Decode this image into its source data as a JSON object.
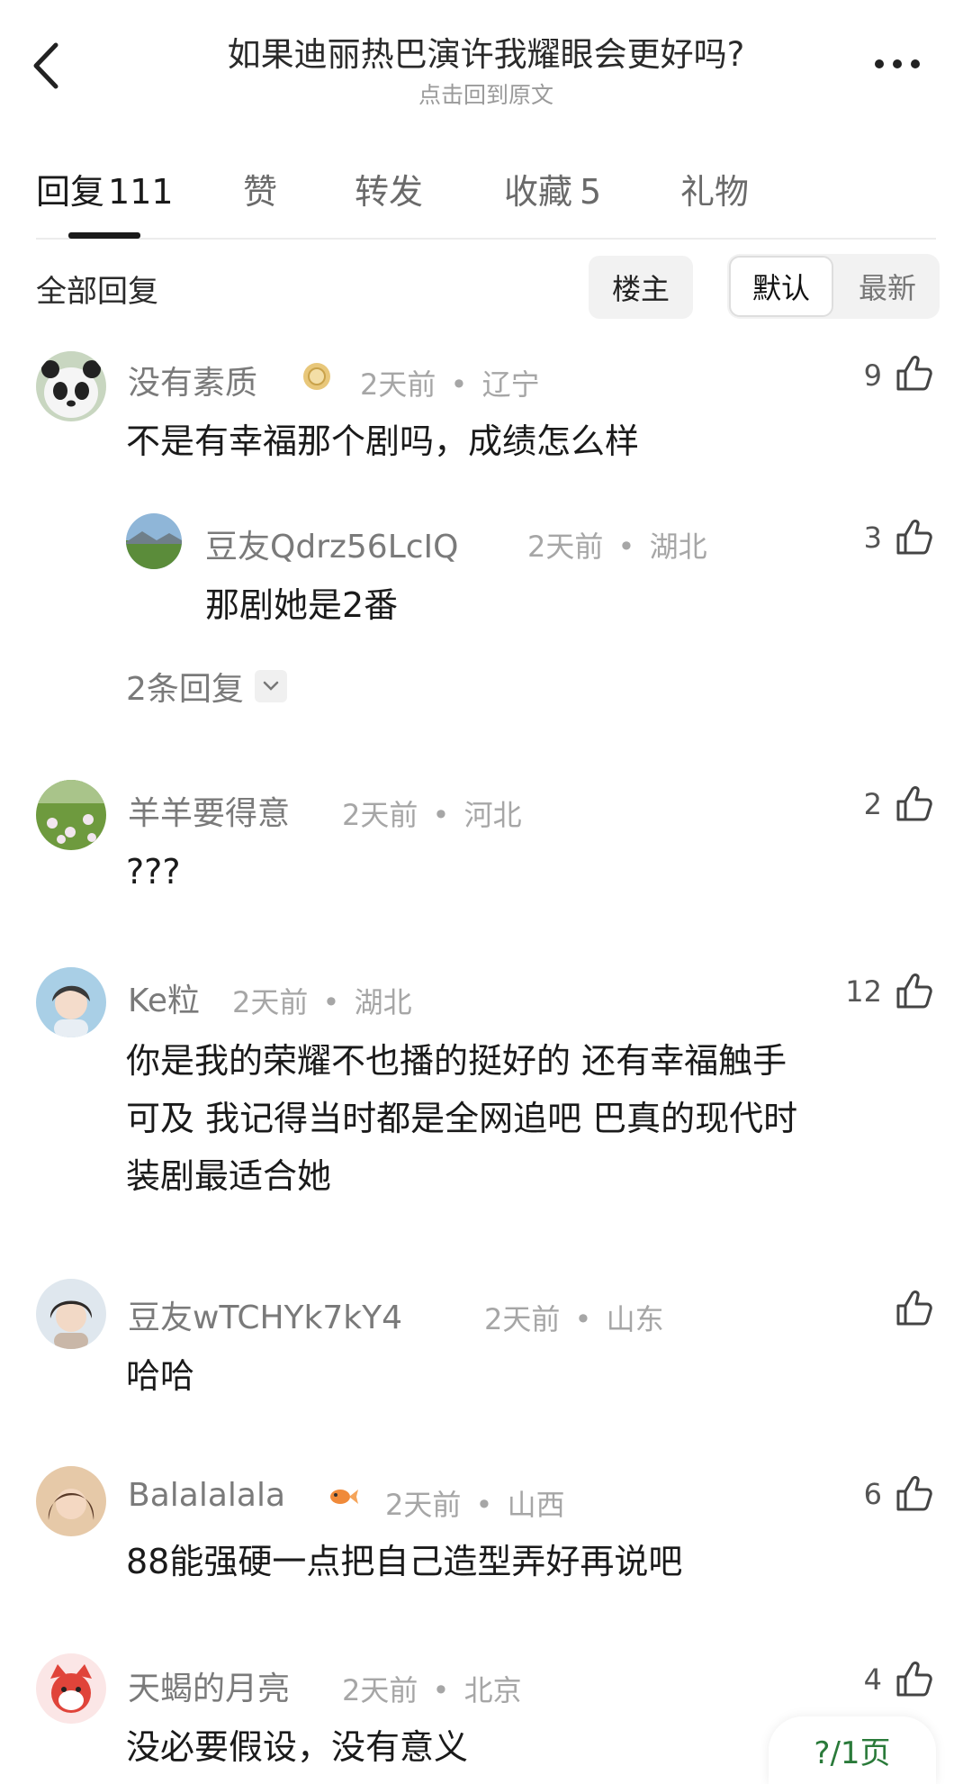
{
  "header": {
    "title": "如果迪丽热巴演许我耀眼会更好吗?",
    "subtitle": "点击回到原文"
  },
  "tabs": [
    {
      "label": "回复",
      "count": "111"
    },
    {
      "label": "赞"
    },
    {
      "label": "转发"
    },
    {
      "label": "收藏",
      "count": "5"
    },
    {
      "label": "礼物"
    }
  ],
  "filter": {
    "all_label": "全部回复",
    "op_label": "楼主",
    "sort_default": "默认",
    "sort_latest": "最新"
  },
  "comments": [
    {
      "name": "没有素质",
      "time": "2天前",
      "location": "辽宁",
      "likes": "9",
      "text": "不是有幸福那个剧吗，成绩怎么样",
      "reply": {
        "name": "豆友Qdrz56LcIQ",
        "time": "2天前",
        "location": "湖北",
        "likes": "3",
        "text": "那剧她是2番"
      },
      "expand_label": "2条回复"
    },
    {
      "name": "羊羊要得意",
      "time": "2天前",
      "location": "河北",
      "likes": "2",
      "text": "???"
    },
    {
      "name": "Ke粒",
      "time": "2天前",
      "location": "湖北",
      "likes": "12",
      "text_lines": [
        "你是我的荣耀不也播的挺好的 还有幸福触手",
        "可及 我记得当时都是全网追吧 巴真的现代时",
        "装剧最适合她"
      ]
    },
    {
      "name": "豆友wTCHYk7kY4",
      "time": "2天前",
      "location": "山东",
      "likes": "",
      "text": "哈哈"
    },
    {
      "name": "Balalalala",
      "time": "2天前",
      "location": "山西",
      "likes": "6",
      "text": "88能强硬一点把自己造型弄好再说吧"
    },
    {
      "name": "天蝎的月亮",
      "time": "2天前",
      "location": "北京",
      "likes": "4",
      "text": "没必要假设，没有意义"
    }
  ],
  "floating_button": "?/1页",
  "separator": "•"
}
